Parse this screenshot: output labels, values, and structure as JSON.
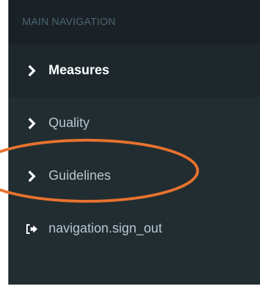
{
  "sidebar": {
    "header": "MAIN NAVIGATION",
    "items": [
      {
        "label": "Measures",
        "icon": "chevron-right-icon",
        "active": true
      },
      {
        "label": "Quality",
        "icon": "chevron-right-icon",
        "active": false
      },
      {
        "label": "Guidelines",
        "icon": "chevron-right-icon",
        "active": false
      },
      {
        "label": "navigation.sign_out",
        "icon": "sign-out-icon",
        "active": false
      }
    ]
  },
  "annotation": {
    "shape": "ellipse",
    "color": "#e8722e",
    "target": "Guidelines"
  },
  "colors": {
    "sidebar_bg": "#222d32",
    "header_bg": "#1a2226",
    "header_text": "#4b646f",
    "item_text": "#b8c7ce",
    "active_text": "#ffffff"
  }
}
